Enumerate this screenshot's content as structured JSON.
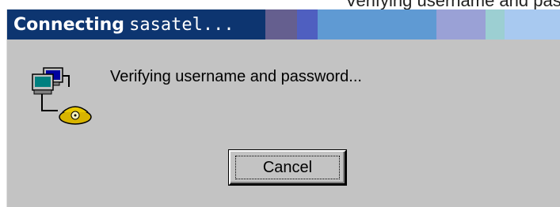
{
  "top_crop": {
    "text": "Verifying username and password..."
  },
  "window": {
    "title_prefix": "Connecting",
    "title_name": "sasatel...",
    "status_text": "Verifying username and password...",
    "cancel_label": "Cancel",
    "icon": "network-dialup-icon",
    "colors": {
      "title_bar_start": "#0a2f6e",
      "title_bar_end": "#a6c8f0",
      "face": "#c3c3c3",
      "title_text": "#ffffff"
    }
  }
}
